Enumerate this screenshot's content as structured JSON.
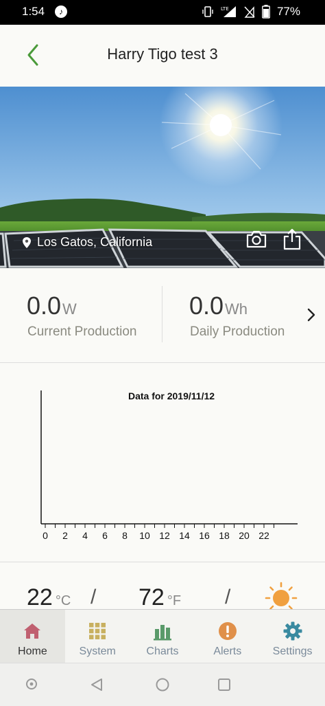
{
  "status_bar": {
    "time": "1:54",
    "battery": "77%",
    "network": "LTE"
  },
  "header": {
    "title": "Harry Tigo test 3",
    "accent": "#4a9a3a"
  },
  "hero": {
    "location": "Los Gatos, California"
  },
  "production": {
    "current_value": "0.0",
    "current_unit": "W",
    "current_label": "Current Production",
    "daily_value": "0.0",
    "daily_unit": "Wh",
    "daily_label": "Daily Production"
  },
  "chart_data": {
    "type": "bar",
    "title": "Data for 2019/11/12",
    "categories": [
      "0",
      "2",
      "4",
      "6",
      "8",
      "10",
      "12",
      "14",
      "16",
      "18",
      "20",
      "22"
    ],
    "values": [],
    "xlabel": "",
    "ylabel": ""
  },
  "weather": {
    "celsius": "22",
    "celsius_unit": "°C",
    "fahrenheit": "72",
    "fahrenheit_unit": "°F",
    "sun_color": "#f0a040"
  },
  "tabs": [
    {
      "label": "Home",
      "icon": "home-icon",
      "color": "#c06070"
    },
    {
      "label": "System",
      "icon": "grid-icon",
      "color": "#c8b060"
    },
    {
      "label": "Charts",
      "icon": "bar-chart-icon",
      "color": "#5a9a6a"
    },
    {
      "label": "Alerts",
      "icon": "alert-icon",
      "color": "#e0904a"
    },
    {
      "label": "Settings",
      "icon": "gear-icon",
      "color": "#3a8aa0"
    }
  ]
}
